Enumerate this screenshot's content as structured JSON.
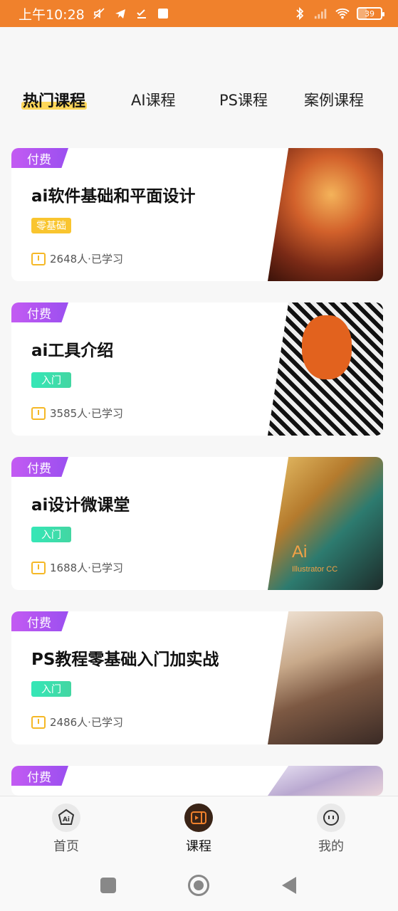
{
  "status_bar": {
    "time": "上午10:28",
    "battery": "39"
  },
  "tabs": [
    {
      "label": "热门课程",
      "active": true
    },
    {
      "label": "AI课程",
      "active": false
    },
    {
      "label": "PS课程",
      "active": false
    },
    {
      "label": "案例课程",
      "active": false
    }
  ],
  "courses": [
    {
      "tag": "付费",
      "title": "ai软件基础和平面设计",
      "level": "零基础",
      "learners": "2648人·已学习"
    },
    {
      "tag": "付费",
      "title": "ai工具介绍",
      "level": "入门",
      "learners": "3585人·已学习"
    },
    {
      "tag": "付费",
      "title": "ai设计微课堂",
      "level": "入门",
      "learners": "1688人·已学习",
      "image_text": "Ai",
      "image_subtext": "Illustrator CC"
    },
    {
      "tag": "付费",
      "title": "PS教程零基础入门加实战",
      "level": "入门",
      "learners": "2486人·已学习"
    },
    {
      "tag": "付费"
    }
  ],
  "bottom_nav": [
    {
      "label": "首页",
      "icon": "ai-home-icon",
      "icon_text": "Ai"
    },
    {
      "label": "课程",
      "icon": "course-icon",
      "active": true
    },
    {
      "label": "我的",
      "icon": "profile-icon"
    }
  ],
  "colors": {
    "status_bar": "#f0812c",
    "paid_tag": "#b456f1",
    "level_zero": "#f9c52f",
    "level_entry": "#3fe1b0",
    "tab_highlight": "#ffd75a"
  }
}
